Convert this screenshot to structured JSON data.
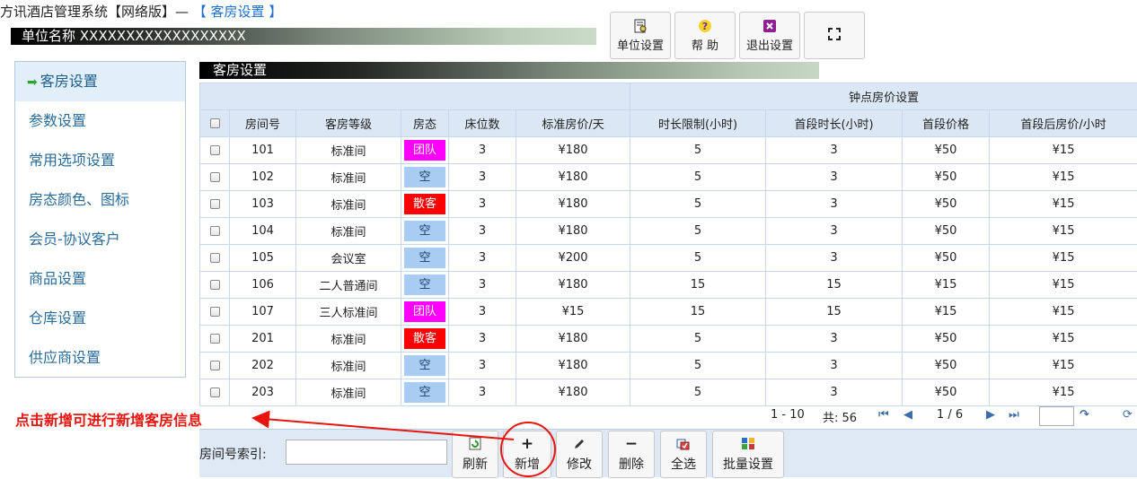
{
  "app": {
    "title_prefix": "方讯酒店管理系统【网络版】— ",
    "title_section": "【 客房设置 】",
    "unit_name": "单位名称 XXXXXXXXXXXXXXXXXX"
  },
  "top_buttons": {
    "unit_settings": "单位设置",
    "help": "帮 助",
    "exit_settings": "退出设置"
  },
  "sidebar": {
    "items": [
      {
        "label": "客房设置"
      },
      {
        "label": "参数设置"
      },
      {
        "label": "常用选项设置"
      },
      {
        "label": "房态颜色、图标"
      },
      {
        "label": "会员-协议客户"
      },
      {
        "label": "商品设置"
      },
      {
        "label": "仓库设置"
      },
      {
        "label": "供应商设置"
      }
    ]
  },
  "panel": {
    "title": "客房设置"
  },
  "table": {
    "group_header": "钟点房价设置",
    "columns": [
      "房间号",
      "客房等级",
      "房态",
      "床位数",
      "标准房价/天",
      "时长限制(小时)",
      "首段时长(小时)",
      "首段价格",
      "首段后房价/小时"
    ],
    "rows": [
      [
        "101",
        "标准间",
        "团队",
        "3",
        "¥180",
        "5",
        "3",
        "¥50",
        "¥15"
      ],
      [
        "102",
        "标准间",
        "空",
        "3",
        "¥180",
        "5",
        "3",
        "¥50",
        "¥15"
      ],
      [
        "103",
        "标准间",
        "散客",
        "3",
        "¥180",
        "5",
        "3",
        "¥50",
        "¥15"
      ],
      [
        "104",
        "标准间",
        "空",
        "3",
        "¥180",
        "5",
        "3",
        "¥50",
        "¥15"
      ],
      [
        "105",
        "会议室",
        "空",
        "3",
        "¥200",
        "5",
        "3",
        "¥50",
        "¥15"
      ],
      [
        "106",
        "二人普通间",
        "空",
        "3",
        "¥180",
        "15",
        "15",
        "¥15",
        "¥15"
      ],
      [
        "107",
        "三人标准间",
        "团队",
        "3",
        "¥15",
        "15",
        "15",
        "¥15",
        "¥15"
      ],
      [
        "201",
        "标准间",
        "散客",
        "3",
        "¥180",
        "5",
        "3",
        "¥50",
        "¥15"
      ],
      [
        "202",
        "标准间",
        "空",
        "3",
        "¥180",
        "5",
        "3",
        "¥50",
        "¥15"
      ],
      [
        "203",
        "标准间",
        "空",
        "3",
        "¥180",
        "5",
        "3",
        "¥50",
        "¥15"
      ]
    ],
    "status_colors": {
      "团队": "#ff00ff",
      "空": "#a9cdf2",
      "散客": "#ff0000"
    },
    "status_text_colors": {
      "团队": "#ffffff",
      "空": "#1a3e6e",
      "散客": "#ffffff"
    }
  },
  "pager": {
    "range": "1 - 10",
    "total": "共: 56",
    "page": "1 / 6"
  },
  "toolbar": {
    "search_label": "房间号索引:",
    "refresh": "刷新",
    "add": "新增",
    "edit": "修改",
    "delete": "删除",
    "select_all": "全选",
    "batch": "批量设置"
  },
  "annotation": {
    "text": "点击新增可进行新增客房信息",
    "color": "#e8140e"
  }
}
